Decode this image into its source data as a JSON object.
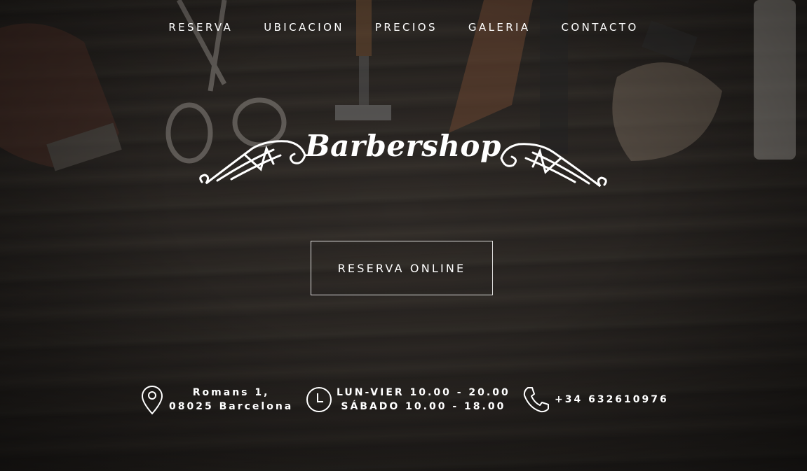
{
  "nav": {
    "items": [
      {
        "label": "RESERVA"
      },
      {
        "label": "UBICACION"
      },
      {
        "label": "PRECIOS"
      },
      {
        "label": "GALERIA"
      },
      {
        "label": "CONTACTO"
      }
    ]
  },
  "logo": {
    "text": "Barbershop"
  },
  "cta": {
    "label": "RESERVA ONLINE"
  },
  "info": {
    "address": {
      "icon": "map-pin-icon",
      "line1": "Romans 1,",
      "line2": "08025 Barcelona"
    },
    "hours": {
      "icon": "clock-icon",
      "line1": "LUN-VIER 10.00 - 20.00",
      "line2": "SÁBADO 10.00 - 18.00"
    },
    "phone": {
      "icon": "phone-icon",
      "number": "+34 632610976"
    }
  },
  "colors": {
    "text": "#ffffff",
    "background": "#2f2a26"
  }
}
